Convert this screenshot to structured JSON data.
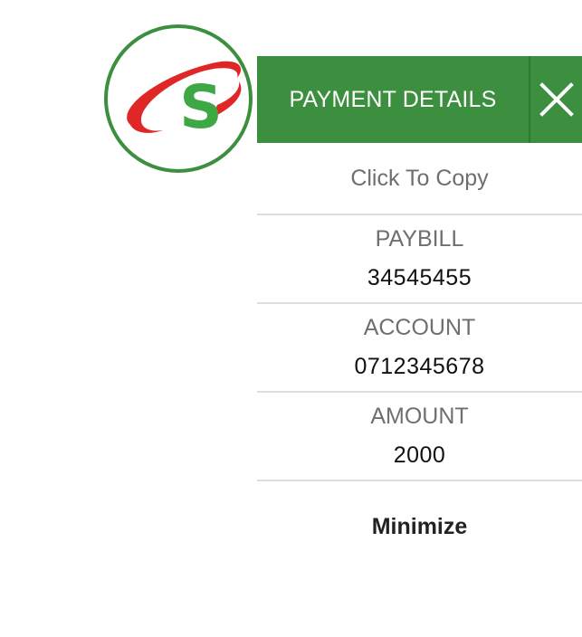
{
  "logo": {
    "letter": "S",
    "ring_color": "#3b8f3e",
    "swoosh_color": "#e02727",
    "letter_color": "#3ea845"
  },
  "header": {
    "title": "PAYMENT DETAILS",
    "close_icon": "close-icon",
    "background": "#3b8f3e"
  },
  "copy_hint": "Click To Copy",
  "fields": [
    {
      "label": "PAYBILL",
      "value": "34545455"
    },
    {
      "label": "ACCOUNT",
      "value": "0712345678"
    },
    {
      "label": "AMOUNT",
      "value": "2000"
    }
  ],
  "minimize_label": "Minimize"
}
